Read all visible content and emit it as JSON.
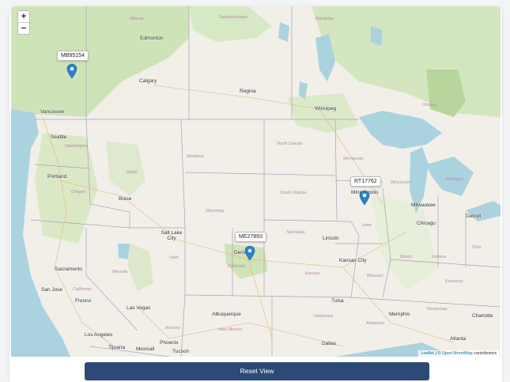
{
  "zoom": {
    "in_label": "+",
    "out_label": "−"
  },
  "cities": [
    {
      "name": "Edmonton"
    },
    {
      "name": "Calgary"
    },
    {
      "name": "Regina"
    },
    {
      "name": "Winnipeg"
    },
    {
      "name": "Vancouver"
    },
    {
      "name": "Seattle"
    },
    {
      "name": "Portland"
    },
    {
      "name": "Boise"
    },
    {
      "name": "Salt Lake City"
    },
    {
      "name": "Denver"
    },
    {
      "name": "Minneapolis"
    },
    {
      "name": "Milwaukee"
    },
    {
      "name": "Detroit"
    },
    {
      "name": "Chicago"
    },
    {
      "name": "Lincoln"
    },
    {
      "name": "Kansas City"
    },
    {
      "name": "Sacramento"
    },
    {
      "name": "San Jose"
    },
    {
      "name": "Fresno"
    },
    {
      "name": "Las Vegas"
    },
    {
      "name": "Los Angeles"
    },
    {
      "name": "Tijuana"
    },
    {
      "name": "Mexicali"
    },
    {
      "name": "Phoenix"
    },
    {
      "name": "Tucson"
    },
    {
      "name": "Albuquerque"
    },
    {
      "name": "Tulsa"
    },
    {
      "name": "Memphis"
    },
    {
      "name": "Dallas"
    },
    {
      "name": "Atlanta"
    },
    {
      "name": "Charlotte"
    }
  ],
  "regions": [
    {
      "name": "Alberta"
    },
    {
      "name": "Saskatchewan"
    },
    {
      "name": "Manitoba"
    },
    {
      "name": "Washington"
    },
    {
      "name": "Oregon"
    },
    {
      "name": "Idaho"
    },
    {
      "name": "Montana"
    },
    {
      "name": "Wyoming"
    },
    {
      "name": "North Dakota"
    },
    {
      "name": "South Dakota"
    },
    {
      "name": "Nebraska"
    },
    {
      "name": "Iowa"
    },
    {
      "name": "Utah"
    },
    {
      "name": "Colorado"
    },
    {
      "name": "Kansas"
    },
    {
      "name": "Missouri"
    },
    {
      "name": "Nevada"
    },
    {
      "name": "California"
    },
    {
      "name": "Arizona"
    },
    {
      "name": "New Mexico"
    },
    {
      "name": "Oklahoma"
    },
    {
      "name": "Arkansas"
    },
    {
      "name": "Illinois"
    },
    {
      "name": "Indiana"
    },
    {
      "name": "Ohio"
    },
    {
      "name": "Wisconsin"
    },
    {
      "name": "Michigan"
    },
    {
      "name": "Minnesota"
    },
    {
      "name": "Tennessee"
    },
    {
      "name": "Kentucky"
    },
    {
      "name": "Ontario"
    }
  ],
  "markers": [
    {
      "id": "MB95154"
    },
    {
      "id": "RT17762"
    },
    {
      "id": "ME27893"
    }
  ],
  "attribution": {
    "leaflet": "Leaflet",
    "sep": " | © ",
    "osm": "OpenStreetMap",
    "suffix": " contributors"
  },
  "reset_button": {
    "label": "Reset View"
  },
  "colors": {
    "water": "#aad3df",
    "land": "#f2efe9",
    "forest": "#c8dfb0",
    "button": "#2c4a75",
    "marker": "#2a81cb"
  }
}
